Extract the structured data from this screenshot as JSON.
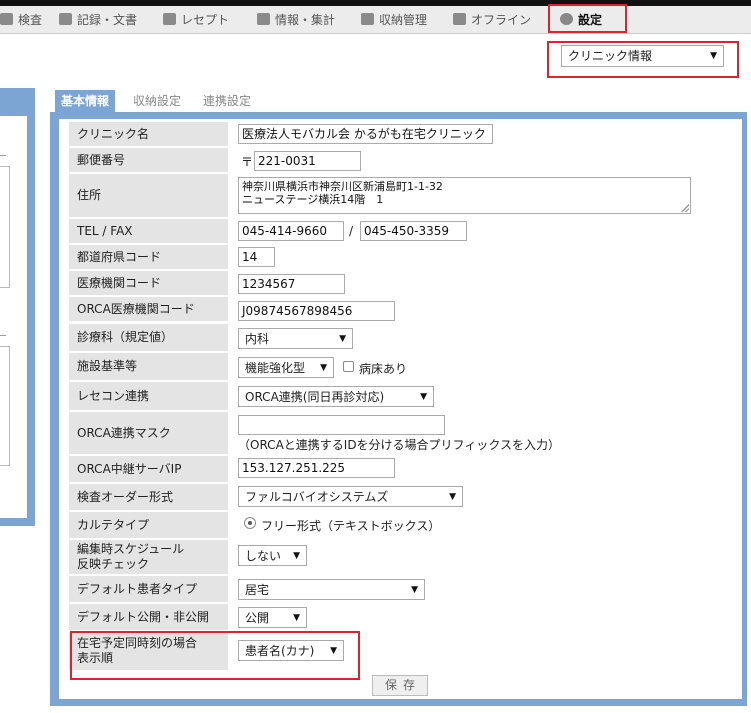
{
  "nav": {
    "items": [
      {
        "label": "検査",
        "icon": "test-icon"
      },
      {
        "label": "記録・文書",
        "icon": "document-icon"
      },
      {
        "label": "レセプト",
        "icon": "receipt-icon"
      },
      {
        "label": "情報・集計",
        "icon": "statistics-icon"
      },
      {
        "label": "収納管理",
        "icon": "payment-icon"
      },
      {
        "label": "オフライン",
        "icon": "offline-icon"
      },
      {
        "label": "設定",
        "icon": "gear-icon",
        "active": true
      }
    ]
  },
  "clinic_select": {
    "value": "クリニック情報"
  },
  "tabs": [
    {
      "label": "基本情報",
      "active": true
    },
    {
      "label": "収納設定"
    },
    {
      "label": "連携設定"
    }
  ],
  "form": {
    "clinic_name": {
      "label": "クリニック名",
      "value": "医療法人モバカル会 かるがも在宅クリニック"
    },
    "postal": {
      "label": "郵便番号",
      "prefix": "〒",
      "value": "221-0031"
    },
    "address": {
      "label": "住所",
      "line1": "神奈川県横浜市神奈川区新浦島町1-1-32",
      "line2": "ニューステージ横浜14階　1"
    },
    "tel_fax": {
      "label": "TEL / FAX",
      "tel": "045-414-9660",
      "separator": "/",
      "fax": "045-450-3359"
    },
    "prefecture_code": {
      "label": "都道府県コード",
      "value": "14"
    },
    "institution_code": {
      "label": "医療機関コード",
      "value": "1234567"
    },
    "orca_institution_code": {
      "label": "ORCA医療機関コード",
      "value": "J09874567898456"
    },
    "department": {
      "label": "診療科（規定値）",
      "value": "内科"
    },
    "facility_standard": {
      "label": "施設基準等",
      "value": "機能強化型",
      "checkbox_label": "病床あり"
    },
    "rececon": {
      "label": "レセコン連携",
      "value": "ORCA連携(同日再診対応)"
    },
    "orca_mask": {
      "label": "ORCA連携マスク",
      "value": "",
      "hint": "（ORCAと連携するIDを分ける場合プリフィックスを入力）"
    },
    "orca_relay_ip": {
      "label": "ORCA中継サーバIP",
      "value": "153.127.251.225"
    },
    "exam_order": {
      "label": "検査オーダー形式",
      "value": "ファルコバイオシステムズ"
    },
    "chart_type": {
      "label": "カルテタイプ",
      "value": "フリー形式（テキストボックス）"
    },
    "schedule_check": {
      "label_line1": "編集時スケジュール",
      "label_line2": "反映チェック",
      "value": "しない"
    },
    "default_patient_type": {
      "label": "デフォルト患者タイプ",
      "value": "居宅"
    },
    "default_visibility": {
      "label": "デフォルト公開・非公開",
      "value": "公開"
    },
    "display_order": {
      "label_line1": "在宅予定同時刻の場合",
      "label_line2": "表示順",
      "value": "患者名(カナ)"
    },
    "save_label": "保存"
  },
  "colors": {
    "highlight": "#d9252b",
    "panel": "#7da5d4",
    "label_bg": "#e4e4e4"
  }
}
